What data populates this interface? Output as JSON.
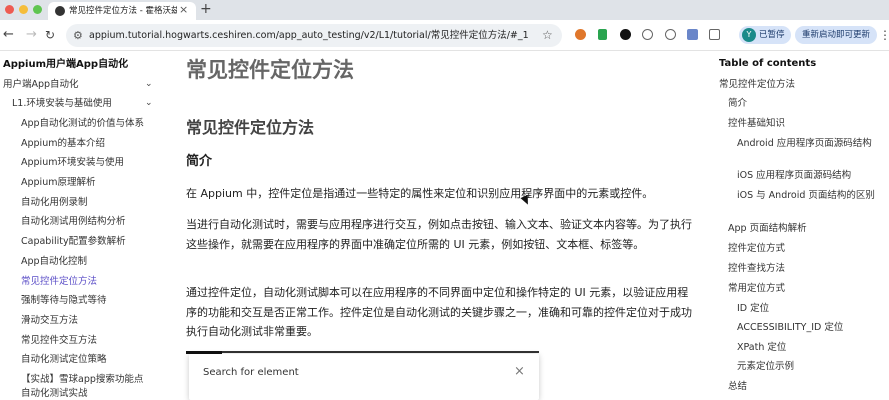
{
  "browser": {
    "tab": {
      "title": "常见控件定位方法 - 霍格沃兹测",
      "close": "×"
    },
    "new_tab": "+",
    "nav": {
      "back": "←",
      "forward": "→",
      "reload": "↻"
    },
    "url": "appium.tutorial.hogwarts.ceshiren.com/app_auto_testing/v2/L1/tutorial/常见控件定位方法/#_1",
    "star": "☆",
    "profile": {
      "avatar_letter": "Y",
      "label": "已暂停"
    },
    "restart_label": "重新启动即可更新",
    "menu": "⋮",
    "icons": [
      "tab-favicon",
      "site-info-icon",
      "star-icon",
      "extension-icons",
      "kebab-menu-icon"
    ]
  },
  "sidebar": {
    "site_title": "Appium用户端App自动化",
    "items": [
      {
        "label": "用户端App自动化",
        "chevron": "⌄"
      },
      {
        "label": "L1.环境安装与基础使用",
        "chevron": "⌄"
      },
      {
        "label": "App自动化测试的价值与体系"
      },
      {
        "label": "Appium的基本介绍"
      },
      {
        "label": "Appium环境安装与使用"
      },
      {
        "label": "Appium原理解析"
      },
      {
        "label": "自动化用例录制"
      },
      {
        "label": "自动化测试用例结构分析"
      },
      {
        "label": "Capability配置参数解析"
      },
      {
        "label": "App自动化控制"
      },
      {
        "label": "常见控件定位方法",
        "active": true
      },
      {
        "label": "强制等待与隐式等待"
      },
      {
        "label": "滑动交互方法"
      },
      {
        "label": "常见控件交互方法"
      },
      {
        "label": "自动化测试定位策略"
      },
      {
        "label": "【实战】雪球app搜索功能点"
      },
      {
        "label": "自动化测试实战"
      }
    ]
  },
  "main": {
    "page_title": "常见控件定位方法",
    "section_title": "常见控件定位方法",
    "intro_heading": "简介",
    "paragraphs": [
      "在 Appium 中，控件定位是指通过一些特定的属性来定位和识别应用程序界面中的元素或控件。",
      "当进行自动化测试时，需要与应用程序进行交互，例如点击按钮、输入文本、验证文本内容等。为了执行这些操作，就需要在应用程序的界面中准确定位所需的 UI 元素，例如按钮、文本框、标签等。",
      "通过控件定位，自动化测试脚本可以在应用程序的不同界面中定位和操作特定的 UI 元素，以验证应用程序的功能和交互是否正常工作。控件定位是自动化测试的关键步骤之一，准确和可靠的控件定位对于成功执行自动化测试非常重要。"
    ],
    "search_panel": {
      "label": "Search for element",
      "close": "×"
    }
  },
  "toc": {
    "title": "Table of contents",
    "items": [
      {
        "label": "常见控件定位方法",
        "level": 0
      },
      {
        "label": "简介",
        "level": 1
      },
      {
        "label": "控件基础知识",
        "level": 1
      },
      {
        "label": "Android 应用程序页面源码结构",
        "level": 2
      },
      {
        "label": "iOS 应用程序页面源码结构",
        "level": 2
      },
      {
        "label": "iOS 与 Android 页面结构的区别",
        "level": 2
      },
      {
        "label": "App 页面结构解析",
        "level": 1
      },
      {
        "label": "控件定位方式",
        "level": 1
      },
      {
        "label": "控件查找方法",
        "level": 1
      },
      {
        "label": "常用定位方式",
        "level": 1
      },
      {
        "label": "ID 定位",
        "level": 2
      },
      {
        "label": "ACCESSIBILITY_ID 定位",
        "level": 2
      },
      {
        "label": "XPath 定位",
        "level": 2
      },
      {
        "label": "元素定位示例",
        "level": 2
      },
      {
        "label": "总结",
        "level": 1
      }
    ]
  }
}
